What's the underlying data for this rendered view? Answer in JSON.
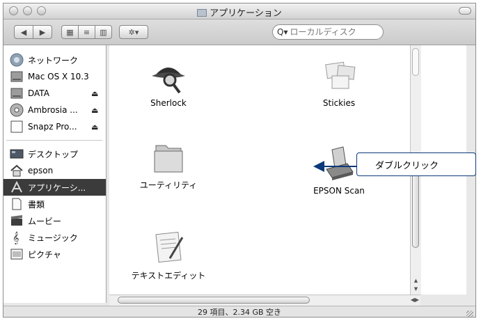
{
  "window": {
    "title": "アプリケーション"
  },
  "toolbar": {
    "back_glyph": "◀",
    "forward_glyph": "▶",
    "view_icons_glyph": "▦",
    "view_list_glyph": "≡",
    "view_columns_glyph": "▥",
    "action_glyph": "✲▾",
    "search_placeholder": "ローカルディスク"
  },
  "sidebar": {
    "devices": [
      {
        "label": "ネットワーク",
        "icon": "network-icon",
        "eject": ""
      },
      {
        "label": "Mac OS X 10.3",
        "icon": "hard-drive-icon",
        "eject": ""
      },
      {
        "label": "DATA",
        "icon": "hard-drive-icon",
        "eject": "⏏"
      },
      {
        "label": "Ambrosia ...",
        "icon": "disk-icon",
        "eject": "⏏"
      },
      {
        "label": "Snapz Pro...",
        "icon": "blank-disk-icon",
        "eject": "⏏"
      }
    ],
    "places": [
      {
        "label": "デスクトップ",
        "icon": "desktop-icon"
      },
      {
        "label": "epson",
        "icon": "home-icon"
      },
      {
        "label": "アプリケーシ...",
        "icon": "applications-icon"
      },
      {
        "label": "書類",
        "icon": "documents-icon"
      },
      {
        "label": "ムービー",
        "icon": "movies-icon"
      },
      {
        "label": "ミュージック",
        "icon": "music-icon"
      },
      {
        "label": "ピクチャ",
        "icon": "pictures-icon"
      }
    ],
    "selected": "アプリケーシ..."
  },
  "files": [
    {
      "name": "Sherlock",
      "icon": "sherlock-icon"
    },
    {
      "name": "Stickies",
      "icon": "stickies-icon"
    },
    {
      "name": "ユーティリティ",
      "icon": "folder-icon"
    },
    {
      "name": "EPSON Scan",
      "icon": "scanner-icon"
    },
    {
      "name": "テキストエディット",
      "icon": "textedit-icon"
    }
  ],
  "status": {
    "text": "29 項目、2.34 GB 空き"
  },
  "callout": {
    "text": "ダブルクリック"
  },
  "colors": {
    "selection": "#3b3b3b",
    "callout_border": "#0b3a7a"
  }
}
